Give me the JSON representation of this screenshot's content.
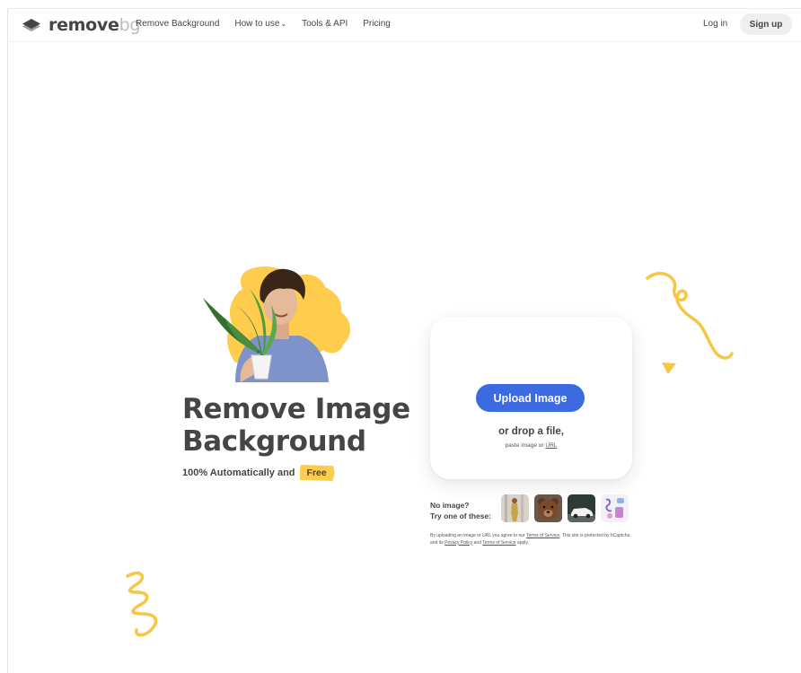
{
  "header": {
    "logo_main": "remove",
    "logo_suffix": "bg",
    "nav": {
      "remove_background": "Remove Background",
      "how_to_use": "How to use",
      "tools_api": "Tools & API",
      "pricing": "Pricing"
    },
    "login": "Log in",
    "signup": "Sign up"
  },
  "hero": {
    "title_line1": "Remove Image",
    "title_line2": "Background",
    "subtitle": "100% Automatically and",
    "free_badge": "Free"
  },
  "upload": {
    "button": "Upload Image",
    "drop": "or drop a file,",
    "paste_prefix": "paste image or",
    "url_link": "URL"
  },
  "samples": {
    "line1": "No image?",
    "line2": "Try one of these:",
    "thumbs": [
      "woman-sample",
      "bear-sample",
      "car-sample",
      "gadgets-sample"
    ]
  },
  "legal": {
    "part1": "By uploading an image or URL you agree to our",
    "tos1": "Terms of Service",
    "part2": ". This site is protected by hCaptcha and its",
    "privacy": "Privacy Policy",
    "part3": "and",
    "tos2": "Terms of Service",
    "part4": "apply."
  },
  "colors": {
    "primary_button": "#3c6ae0",
    "accent_yellow": "#ffcc4d",
    "text": "#454545"
  }
}
